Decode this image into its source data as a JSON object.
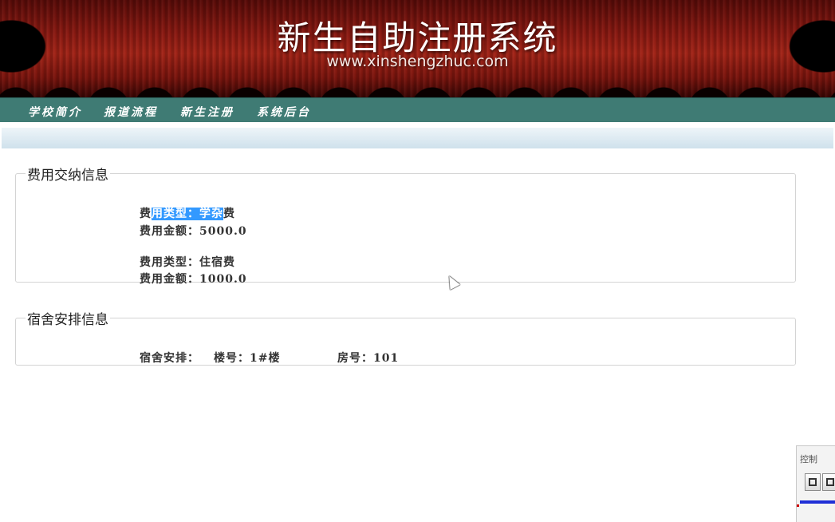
{
  "header": {
    "title": "新生自助注册系统",
    "url_text": "www.xinshengzhuc.com"
  },
  "nav": {
    "items": [
      "学校简介",
      "报道流程",
      "新生注册",
      "系统后台"
    ]
  },
  "fees": {
    "legend": "费用交纳信息",
    "line1_prefix": "费",
    "line1_selected": "用类型：学杂",
    "line1_suffix": "费",
    "line2": "费用金额：5000.0",
    "line3": "费用类型：住宿费",
    "line4": "费用金额：1000.0"
  },
  "dorm": {
    "legend": "宿舍安排信息",
    "label": "宿舍安排：",
    "building": "楼号：1#楼",
    "room": "房号：101"
  },
  "control_panel": {
    "label": "控制"
  },
  "colors": {
    "nav_bg": "#3f7b74",
    "banner_red": "#8e1a12",
    "selection": "#3399ff"
  }
}
